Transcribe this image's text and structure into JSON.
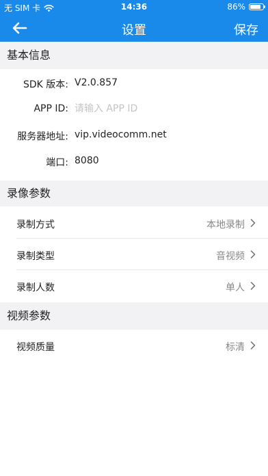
{
  "status_bar": {
    "carrier": "无 SIM 卡",
    "time": "14:36",
    "battery": "86%",
    "battery_level": 0.86
  },
  "nav": {
    "back_icon": "arrow-left-icon",
    "title": "设置",
    "save_label": "保存"
  },
  "basic_info": {
    "header": "基本信息",
    "sdk_label": "SDK 版本:",
    "sdk_value": "V2.0.857",
    "appid_label": "APP ID:",
    "appid_value": "",
    "appid_placeholder": "请输入 APP ID",
    "server_label": "服务器地址:",
    "server_value": "vip.videocomm.net",
    "port_label": "端口:",
    "port_value": "8080"
  },
  "record_params": {
    "header": "录像参数",
    "items": [
      {
        "label": "录制方式",
        "value": "本地录制"
      },
      {
        "label": "录制类型",
        "value": "音视频"
      },
      {
        "label": "录制人数",
        "value": "单人"
      }
    ]
  },
  "video_params": {
    "header": "视频参数",
    "items": [
      {
        "label": "视频质量",
        "value": "标清"
      }
    ]
  },
  "colors": {
    "accent": "#1a8aea",
    "section_bg": "#f2f2f4",
    "secondary_text": "#888888",
    "placeholder": "#c4c4c8"
  }
}
